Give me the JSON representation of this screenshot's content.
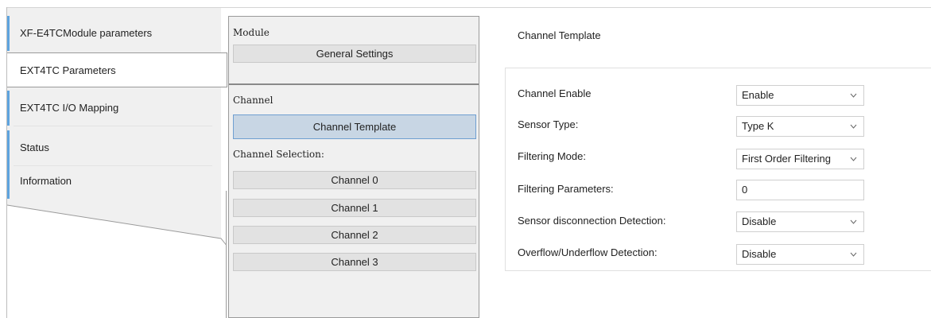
{
  "left_tabs": [
    {
      "label": "XF-E4TCModule parameters",
      "active": false
    },
    {
      "label": "EXT4TC Parameters",
      "active": true
    },
    {
      "label": "EXT4TC I/O Mapping",
      "active": false
    },
    {
      "label": "Status",
      "active": false
    },
    {
      "label": "Information",
      "active": false
    }
  ],
  "middle": {
    "module_label": "Module",
    "general_settings": "General Settings",
    "channel_label": "Channel",
    "channel_template": "Channel Template",
    "channel_selection_label": "Channel Selection:",
    "channels": [
      "Channel 0",
      "Channel 1",
      "Channel 2",
      "Channel 3"
    ]
  },
  "right": {
    "title": "Channel Template",
    "fields": [
      {
        "label": "Channel Enable",
        "value": "Enable",
        "type": "select"
      },
      {
        "label": "Sensor Type:",
        "value": "Type K",
        "type": "select"
      },
      {
        "label": "Filtering Mode:",
        "value": "First Order Filtering",
        "type": "select"
      },
      {
        "label": "Filtering Parameters:",
        "value": "0",
        "type": "text"
      },
      {
        "label": "Sensor disconnection Detection:",
        "value": "Disable",
        "type": "select"
      },
      {
        "label": "Overflow/Underflow Detection:",
        "value": "Disable",
        "type": "select"
      }
    ]
  },
  "colors": {
    "tab_accent": "#5ea4df",
    "selected_button": "#c8d6e4",
    "selected_border": "#6f9fd1",
    "panel_bg": "#f0f0f0"
  },
  "icons": {
    "dropdown": "chevron-down-icon"
  }
}
